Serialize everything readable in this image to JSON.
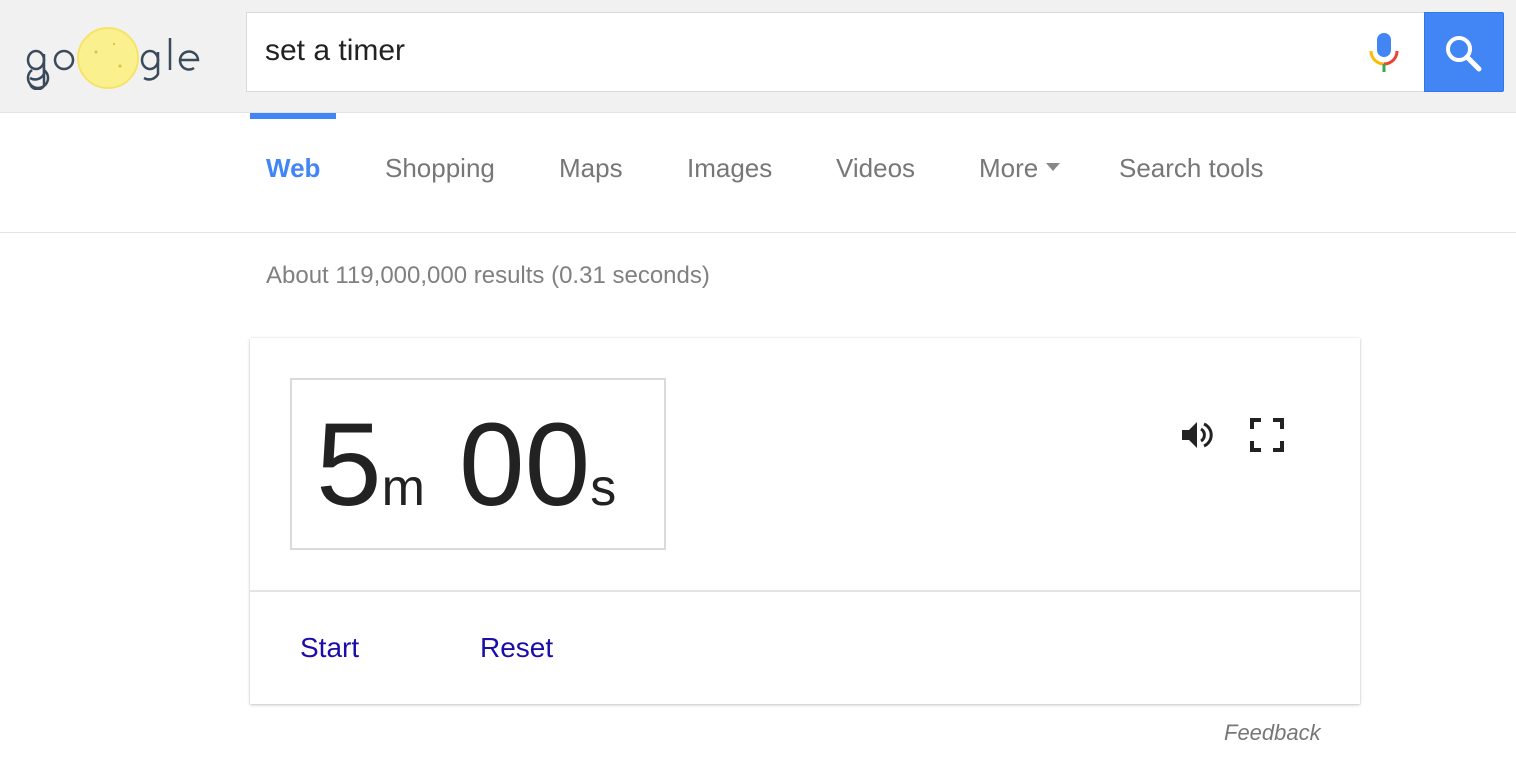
{
  "search": {
    "query": "set a timer",
    "logo_text": "google"
  },
  "tabs": [
    {
      "label": "Web",
      "active": true
    },
    {
      "label": "Shopping",
      "active": false
    },
    {
      "label": "Maps",
      "active": false
    },
    {
      "label": "Images",
      "active": false
    },
    {
      "label": "Videos",
      "active": false
    },
    {
      "label": "More",
      "active": false
    },
    {
      "label": "Search tools",
      "active": false
    }
  ],
  "results": {
    "stats": "About 119,000,000 results (0.31 seconds)"
  },
  "timer": {
    "minutes": "5",
    "minutes_unit": "m",
    "seconds": "00",
    "seconds_unit": "s",
    "start_label": "Start",
    "reset_label": "Reset"
  },
  "footer": {
    "feedback_label": "Feedback"
  },
  "icons": {
    "mic": "microphone-icon",
    "search": "search-icon",
    "volume": "volume-icon",
    "fullscreen": "fullscreen-icon",
    "more": "caret-down-icon"
  },
  "colors": {
    "accent": "#4285f4",
    "link": "#1a0dab",
    "tab_text": "#777777",
    "stats_text": "#808080",
    "topbar_bg": "#f1f1f1"
  }
}
